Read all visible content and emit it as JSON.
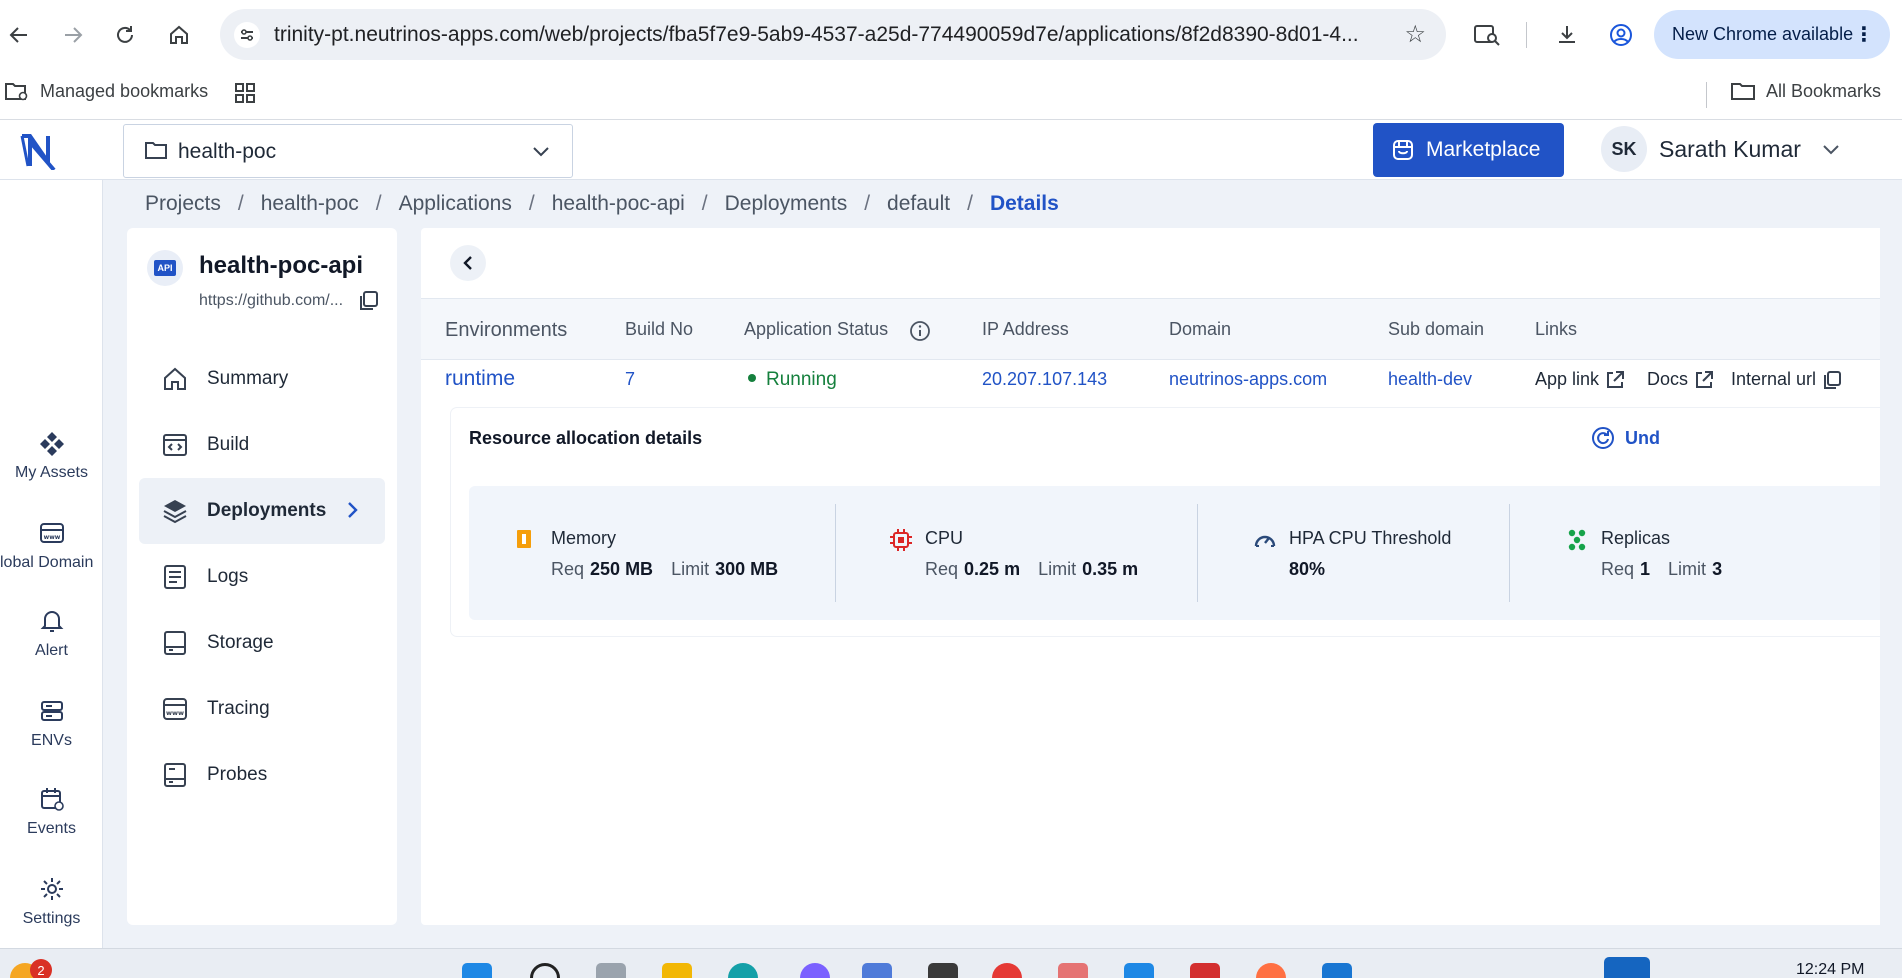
{
  "browser": {
    "url": "trinity-pt.neutrinos-apps.com/web/projects/fba5f7e9-5ab9-4537-a25d-774490059d7e/applications/8f2d8390-8d01-4...",
    "new_chrome_label": "New Chrome available",
    "bookmarks": {
      "managed": "Managed bookmarks",
      "all": "All Bookmarks"
    }
  },
  "header": {
    "project_name": "health-poc",
    "marketplace_label": "Marketplace",
    "user_initials": "SK",
    "user_name": "Sarath Kumar"
  },
  "rail": {
    "items": [
      {
        "label": "My Assets",
        "icon": "assets-icon"
      },
      {
        "label": "lobal Domain",
        "icon": "www-icon"
      },
      {
        "label": "Alert",
        "icon": "bell-icon"
      },
      {
        "label": "ENVs",
        "icon": "server-icon"
      },
      {
        "label": "Events",
        "icon": "calendar-icon"
      },
      {
        "label": "Settings",
        "icon": "gear-icon"
      }
    ]
  },
  "breadcrumb": {
    "items": [
      "Projects",
      "health-poc",
      "Applications",
      "health-poc-api",
      "Deployments",
      "default"
    ],
    "current": "Details"
  },
  "app": {
    "title": "health-poc-api",
    "repo": "https://github.com/...",
    "api_badge": "API"
  },
  "menu": {
    "items": [
      {
        "label": "Summary",
        "icon": "home-icon"
      },
      {
        "label": "Build",
        "icon": "code-window-icon"
      },
      {
        "label": "Deployments",
        "icon": "layers-icon"
      },
      {
        "label": "Logs",
        "icon": "logs-icon"
      },
      {
        "label": "Storage",
        "icon": "storage-icon"
      },
      {
        "label": "Tracing",
        "icon": "www-icon"
      },
      {
        "label": "Probes",
        "icon": "probes-icon"
      }
    ],
    "active": "Deployments"
  },
  "table": {
    "headers": [
      "Environments",
      "Build No",
      "Application Status",
      "IP Address",
      "Domain",
      "Sub domain",
      "Links"
    ],
    "row": {
      "environment": "runtime",
      "build_no": "7",
      "status": "Running",
      "ip": "20.207.107.143",
      "domain": "neutrinos-apps.com",
      "subdomain": "health-dev",
      "links": [
        "App link",
        "Docs",
        "Internal url"
      ]
    }
  },
  "resources": {
    "title": "Resource allocation details",
    "undo_label": "Und",
    "memory": {
      "label": "Memory",
      "req_label": "Req",
      "req": "250 MB",
      "limit_label": "Limit",
      "limit": "300 MB"
    },
    "cpu": {
      "label": "CPU",
      "req_label": "Req",
      "req": "0.25 m",
      "limit_label": "Limit",
      "limit": "0.35 m"
    },
    "hpa": {
      "label": "HPA CPU Threshold",
      "value": "80%"
    },
    "replicas": {
      "label": "Replicas",
      "req_label": "Req",
      "req": "1",
      "limit_label": "Limit",
      "limit": "3"
    }
  },
  "taskbar": {
    "time": "12:24 PM",
    "notification_count": "2"
  },
  "colors": {
    "accent": "#2153c6",
    "running": "#15803d",
    "memory_icon": "#f59e0b",
    "cpu_icon": "#dc2626",
    "replicas_icon": "#16a34a"
  }
}
